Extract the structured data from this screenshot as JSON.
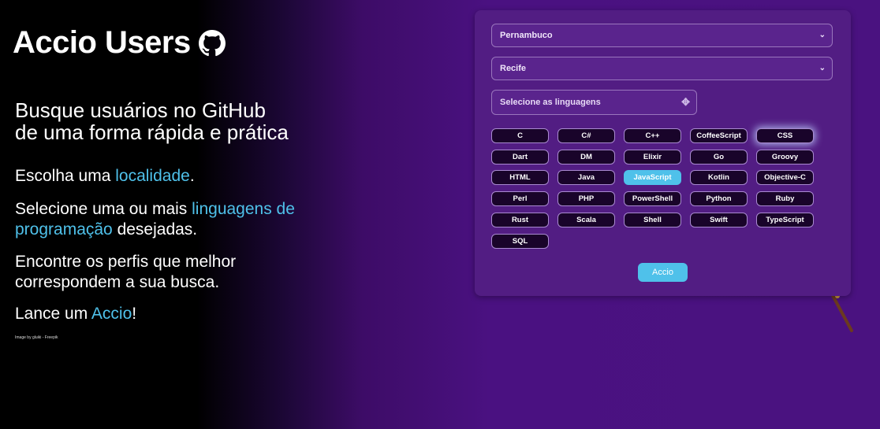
{
  "header": {
    "title": "Accio Users"
  },
  "hero": {
    "headline_line1": "Busque usuários no GitHub",
    "headline_line2": "de uma forma rápida e prática",
    "step1_pre": "Escolha uma ",
    "step1_link": "localidade",
    "step1_post": ".",
    "step2_pre": "Selecione uma ou mais ",
    "step2_link": "linguagens de programação",
    "step2_post": " desejadas.",
    "step3": "Encontre os perfis que melhor correspondem a sua busca.",
    "step4_pre": "Lance um ",
    "step4_link": "Accio",
    "step4_post": "!",
    "credit": "Image by gluiki - Freepik"
  },
  "form": {
    "state_value": "Pernambuco",
    "city_value": "Recife",
    "languages_placeholder": "Selecione as linguagens",
    "submit_label": "Accio"
  },
  "languages": [
    {
      "label": "C",
      "selected": false
    },
    {
      "label": "C#",
      "selected": false
    },
    {
      "label": "C++",
      "selected": false
    },
    {
      "label": "CoffeeScript",
      "selected": false
    },
    {
      "label": "CSS",
      "selected": false
    },
    {
      "label": "Dart",
      "selected": false
    },
    {
      "label": "DM",
      "selected": false
    },
    {
      "label": "Elixir",
      "selected": false
    },
    {
      "label": "Go",
      "selected": false
    },
    {
      "label": "Groovy",
      "selected": false
    },
    {
      "label": "HTML",
      "selected": false
    },
    {
      "label": "Java",
      "selected": false
    },
    {
      "label": "JavaScript",
      "selected": true
    },
    {
      "label": "Kotlin",
      "selected": false
    },
    {
      "label": "Objective-C",
      "selected": false
    },
    {
      "label": "Perl",
      "selected": false
    },
    {
      "label": "PHP",
      "selected": false
    },
    {
      "label": "PowerShell",
      "selected": false
    },
    {
      "label": "Python",
      "selected": false
    },
    {
      "label": "Ruby",
      "selected": false
    },
    {
      "label": "Rust",
      "selected": false
    },
    {
      "label": "Scala",
      "selected": false
    },
    {
      "label": "Shell",
      "selected": false
    },
    {
      "label": "Swift",
      "selected": false
    },
    {
      "label": "TypeScript",
      "selected": false
    },
    {
      "label": "SQL",
      "selected": false
    }
  ],
  "colors": {
    "accent": "#4fc1ea",
    "panel": "#521d83",
    "chip_bg": "#19042a"
  }
}
